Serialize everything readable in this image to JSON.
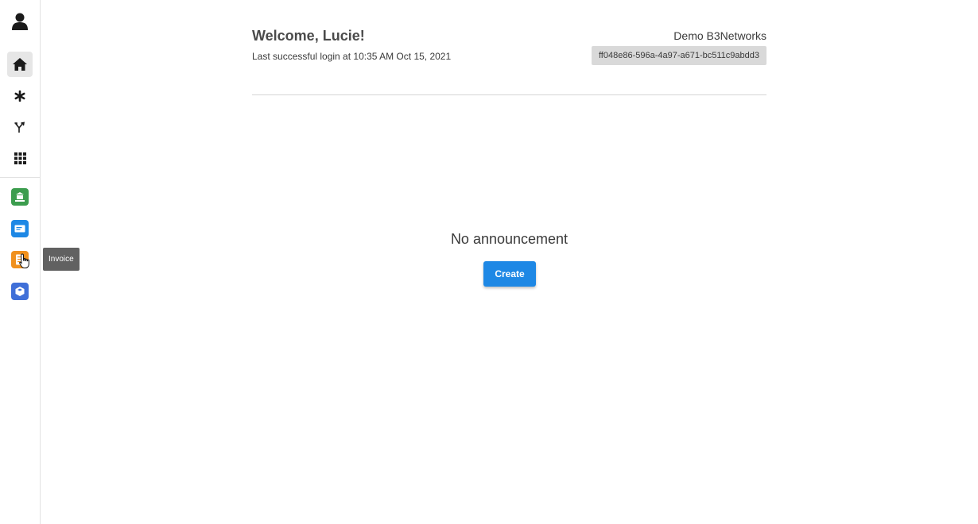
{
  "sidebar": {
    "nav_items": [
      {
        "name": "profile",
        "icon": "user-icon"
      },
      {
        "name": "home",
        "icon": "home-icon",
        "active": true
      },
      {
        "name": "asterisk",
        "icon": "asterisk-icon"
      },
      {
        "name": "routing",
        "icon": "fork-icon"
      },
      {
        "name": "apps",
        "icon": "grid-icon"
      }
    ],
    "apps": [
      {
        "name": "portal-app",
        "icon": "green-app-icon",
        "color": "#3c9d4e"
      },
      {
        "name": "ticket-app",
        "icon": "blue-app-icon",
        "color": "#1e88e5"
      },
      {
        "name": "invoice-app",
        "icon": "invoice-icon",
        "color": "#f0911e"
      },
      {
        "name": "package-app",
        "icon": "box-icon",
        "color": "#3f6fd8"
      }
    ],
    "tooltip": "Invoice"
  },
  "header": {
    "welcome": "Welcome, Lucie!",
    "last_login": "Last successful login at 10:35 AM Oct 15, 2021",
    "org_name": "Demo B3Networks",
    "org_id": "ff048e86-596a-4a97-a671-bc511c9abdd3"
  },
  "main": {
    "empty_message": "No announcement",
    "create_label": "Create"
  },
  "colors": {
    "primary": "#1e88e5",
    "tooltip_bg": "#616161"
  }
}
